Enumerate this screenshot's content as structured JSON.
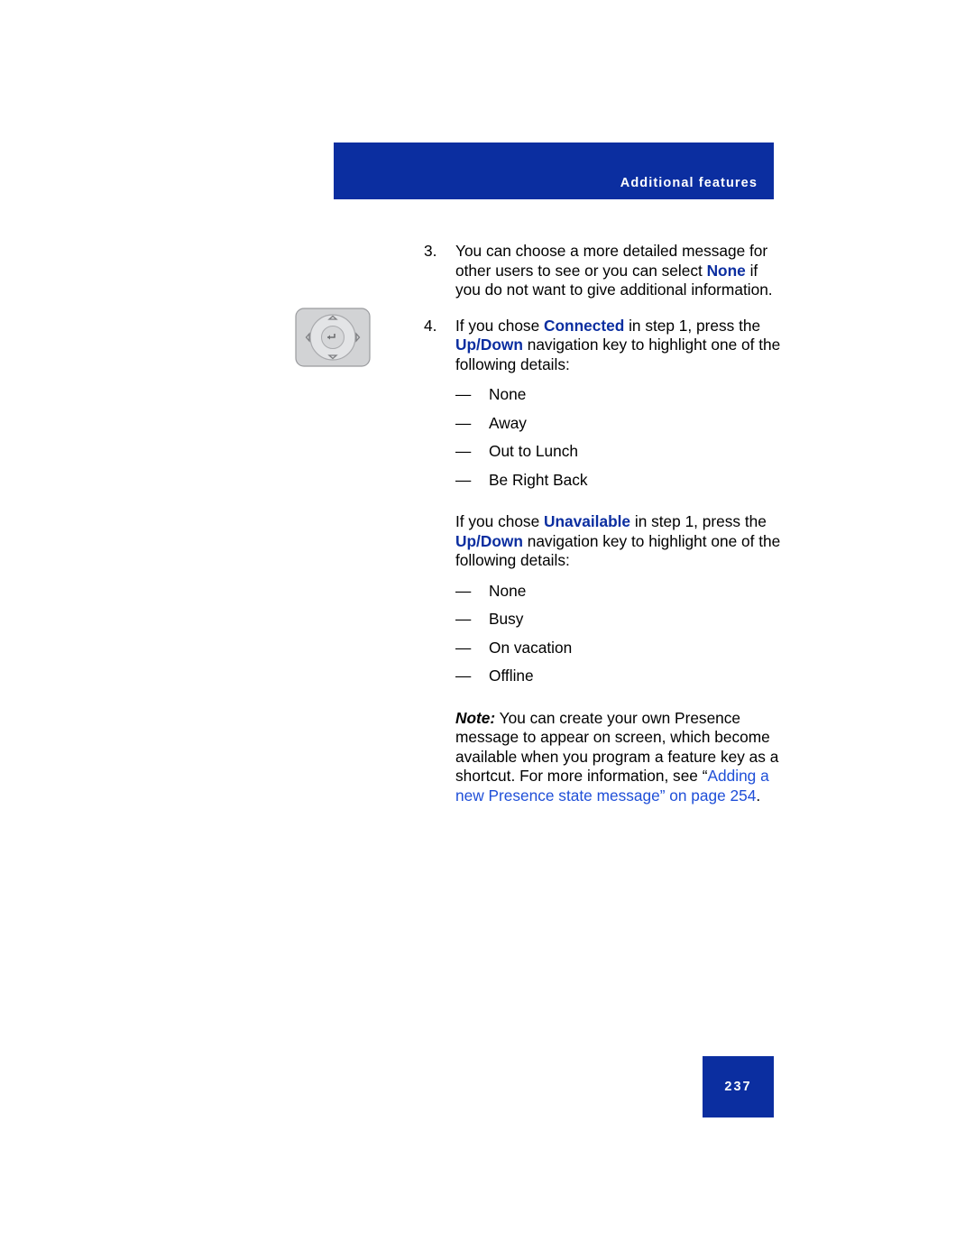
{
  "header": {
    "title": "Additional features",
    "bar_color": "#0b2ea0"
  },
  "page_number": "237",
  "graphic": {
    "name": "navigation-cluster-keypad-illustration"
  },
  "steps": [
    {
      "number": "3.",
      "text_before": "You can choose a more detailed message for other users to see or you can select ",
      "bold": "None",
      "text_after": " if you do not want to give additional information."
    },
    {
      "number": "4.",
      "text_1": "If you chose ",
      "bold_1": "Connected",
      "text_2": " in step 1, press the ",
      "bold_2": "Up",
      "text_3": "/",
      "bold_3": "Down",
      "text_4": " navigation key to highlight one of the following details:"
    }
  ],
  "connected_details": [
    "None",
    "Away",
    "Out to Lunch",
    "Be Right Back"
  ],
  "unavailable_para": {
    "text_1": "If you chose ",
    "bold_1": "Unavailable",
    "text_2": " in step 1, press the ",
    "bold_2": "Up",
    "text_3": "/",
    "bold_3": "Down",
    "text_4": " navigation key to highlight one of the following details:"
  },
  "unavailable_details": [
    "None",
    "Busy",
    "On vacation",
    "Offline"
  ],
  "note": {
    "label": "Note:",
    "text_1": " You can create your own Presence message to appear on screen, which become available when you program a feature key as a shortcut. For more information, see “",
    "link": "Adding a new Presence state message” on page 254",
    "text_2": "."
  },
  "dash": "—",
  "colors": {
    "accent_blue": "#0b2ea0",
    "link_blue": "#1f4fd8"
  }
}
